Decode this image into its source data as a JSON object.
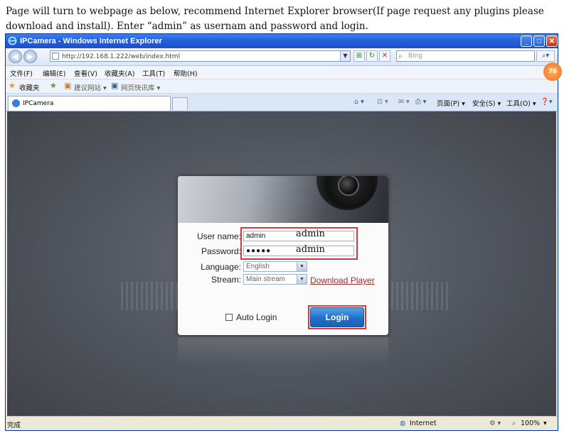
{
  "instruction": "Page will turn to webpage as below, recommend Internet Explorer browser(If page request any plugins please download and install). Enter  “admin” as usernam and password and login.",
  "window": {
    "title": "IPCamera - Windows Internet Explorer"
  },
  "address_bar": {
    "url": "http://192.168.1.222/web/index.html",
    "search_placeholder": "Bing"
  },
  "menu": [
    "文件(F)",
    "编辑(E)",
    "查看(V)",
    "收藏夹(A)",
    "工具(T)",
    "帮助(H)"
  ],
  "favorites_bar": {
    "favorites": "收藏夹",
    "suggested": "建议网站 ▾",
    "gallery": "网页快讯库 ▾"
  },
  "tab": {
    "label": "IPCamera"
  },
  "command_bar": {
    "page": "页面(P) ▾",
    "safety": "安全(S) ▾",
    "tools": "工具(O) ▾"
  },
  "login": {
    "username_label": "User name:",
    "username_value": "admin",
    "username_overlay": "admin",
    "password_label": "Password:",
    "password_value": "●●●●●",
    "password_overlay": "admin",
    "language_label": "Language:",
    "language_value": "English",
    "stream_label": "Stream:",
    "stream_value": "Main stream",
    "download_link": "Download Player",
    "auto_login_label": "Auto Login",
    "login_button": "Login"
  },
  "status_bar": {
    "left": "完成",
    "zone": "Internet",
    "zoom": "100%"
  },
  "badge": "76",
  "colors": {
    "highlight": "#cf3b3b",
    "login_button": "#1f6fc9",
    "link": "#9c2b2b",
    "titlebar": "#2460dc"
  }
}
